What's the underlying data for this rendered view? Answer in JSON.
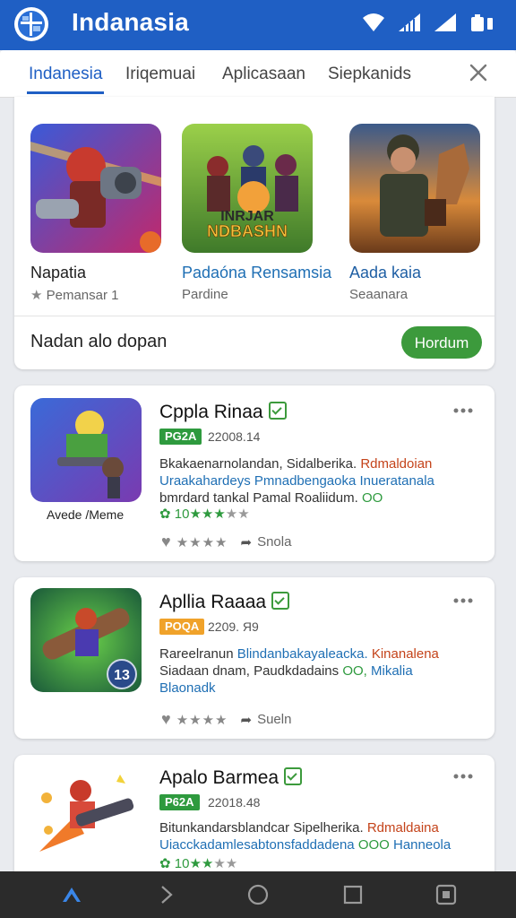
{
  "app": {
    "title": "Indanasia"
  },
  "tabs": [
    {
      "label": "Indanesia"
    },
    {
      "label": "Iriqemuai"
    },
    {
      "label": "Aplicasaan"
    },
    {
      "label": "Siepkanids"
    }
  ],
  "featured": {
    "items": [
      {
        "name": "Napatia",
        "sub": "Pemansar 1",
        "icon": "robot-warrior-art"
      },
      {
        "name": "Padaóna Rensamsia",
        "sub": "Pardine",
        "icon": "soldiers-game-art",
        "art_text_top": "INRJAR",
        "art_text_bottom": "NDBASHN"
      },
      {
        "name": "Aada kaia",
        "sub": "Seaanara",
        "icon": "soldier-horse-art"
      }
    ],
    "footer_text": "Nadan alo dopan",
    "button_label": "Hordum"
  },
  "apps": [
    {
      "title": "Cppla Rinaa",
      "caption": "Avede /Meme",
      "tag": "PG2A",
      "tag_color": "green",
      "date": "22008.14",
      "desc_1a": "Bkakaenarnolandan, Sidalberika. ",
      "desc_1b": "Rdmaldoian",
      "desc_2a": "Uraakahardeys Pmnadbengaoka ",
      "desc_2b": "Inueratanala",
      "desc_3a": "bmrdard tankal Pamal Roaliidum. ",
      "desc_3b": "OO",
      "rating": "10",
      "stars": "★★★",
      "rating_rest": "★★",
      "action_stars": "★★★★",
      "action_label": "Snola"
    },
    {
      "title": "Apllia Raaaa",
      "tag": "POQA",
      "tag_color": "orange",
      "date": "2209. Я9",
      "badge": "13",
      "desc_1a": "Rareelranun ",
      "desc_1b": "Blindanbakayaleacka. ",
      "desc_1c": "Kinanalena",
      "desc_2a": "Siadaan dnam, Paudkdadains ",
      "desc_2b": "OO, ",
      "desc_2c": "Mikalia",
      "desc_3": "Blaonadk",
      "action_stars": "★★★★",
      "action_label": "Sueln"
    },
    {
      "title": "Apalo Barmea",
      "tag": "P62A",
      "tag_color": "green",
      "date": "22018.48",
      "desc_1a": "Bitunkandarsblandcar Sipelherika. ",
      "desc_1b": "Rdmaldaina",
      "desc_2a": "Uiacckadamlesabtonsfaddadena ",
      "desc_2b": "OOO ",
      "desc_2c": "Hanneola",
      "rating": "10",
      "stars": "★★",
      "rating_rest": "★★"
    }
  ]
}
